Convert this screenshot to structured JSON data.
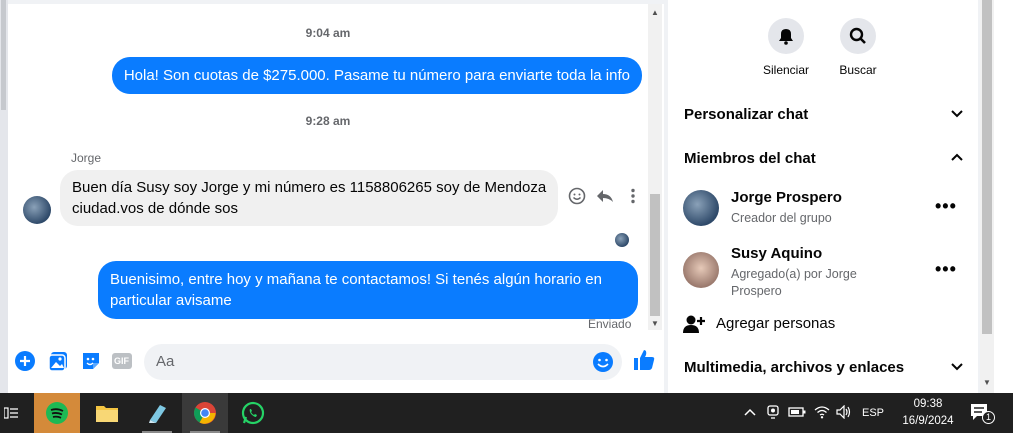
{
  "chat": {
    "timestamp_1": "9:04 am",
    "msg_out_1": "Hola! Son cuotas de $275.000. Pasame tu número para enviarte toda la info",
    "timestamp_2": "9:28 am",
    "sender_name": "Jorge",
    "msg_in_line1": "Buen día Susy soy Jorge y mi número es 1158806265 soy de Mendoza",
    "msg_in_line2": "ciudad.vos de dónde sos",
    "msg_out_2_line1": "Buenisimo, entre hoy y mañana te contactamos! Si tenés algún horario en",
    "msg_out_2_line2": "particular avisame",
    "status": "Enviado"
  },
  "composer": {
    "placeholder": "Aa",
    "gif_label": "GIF"
  },
  "panel": {
    "mute_label": "Silenciar",
    "search_label": "Buscar",
    "customize_label": "Personalizar chat",
    "members_label": "Miembros del chat",
    "members": [
      {
        "name": "Jorge Prospero",
        "sub1": "Creador del grupo",
        "sub2": ""
      },
      {
        "name": "Susy Aquino",
        "sub1": "Agregado(a) por Jorge",
        "sub2": "Prospero"
      }
    ],
    "add_people_label": "Agregar personas",
    "media_label": "Multimedia, archivos y enlaces"
  },
  "taskbar": {
    "language": "ESP",
    "time": "09:38",
    "date": "16/9/2024",
    "notification_count": "1"
  },
  "colors": {
    "accent": "#0a7cff",
    "taskbar": "#202020"
  }
}
